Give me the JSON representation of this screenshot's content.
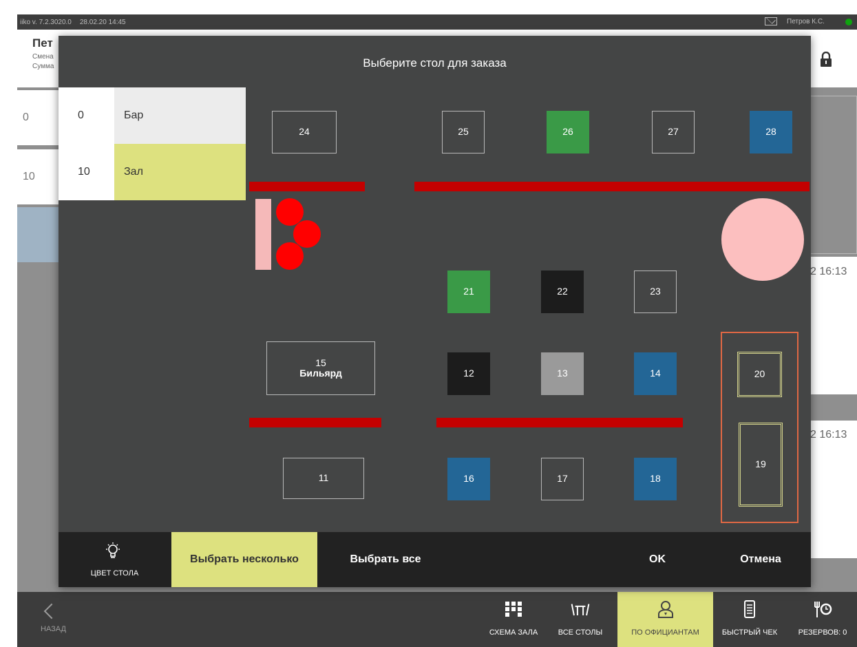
{
  "topbar": {
    "version": "iiko v. 7.2.3020.0",
    "datetime": "28.02.20  14:45",
    "user": "Петров К.С."
  },
  "background": {
    "waiter_name": "Пет",
    "line1": "Смена",
    "line2": "Сумма",
    "side_cells": [
      "0",
      "10"
    ],
    "times": [
      "2 16:13",
      "2 16:13"
    ]
  },
  "bottom_nav": {
    "back": "НАЗАД",
    "items": [
      {
        "label": "СХЕМА ЗАЛА",
        "icon": "grid-icon"
      },
      {
        "label": "ВСЕ СТОЛЫ",
        "icon": "table-icon"
      },
      {
        "label": "ПО ОФИЦИАНТАМ",
        "icon": "waiter-icon",
        "active": true
      },
      {
        "label": "БЫСТРЫЙ ЧЕК",
        "icon": "receipt-icon"
      },
      {
        "label": "РЕЗЕРВОВ: 0",
        "icon": "reserve-icon"
      }
    ]
  },
  "modal": {
    "title": "Выберите стол для заказа",
    "halls": [
      {
        "count": "0",
        "name": "Бар",
        "selected": false
      },
      {
        "count": "10",
        "name": "Зал",
        "selected": true
      }
    ],
    "tables": {
      "t24": "24",
      "t25": "25",
      "t26": "26",
      "t27": "27",
      "t28": "28",
      "t21": "21",
      "t22": "22",
      "t23": "23",
      "t15": "15",
      "t15_name": "Бильярд",
      "t12": "12",
      "t13": "13",
      "t14": "14",
      "t20": "20",
      "t11": "11",
      "t16": "16",
      "t17": "17",
      "t18": "18",
      "t19": "19"
    },
    "colors": {
      "green": "#3a9a47",
      "blue": "#236696",
      "black": "#1c1c1c",
      "gray": "#9a9a9a",
      "wall": "#c40000",
      "accent": "#dde17f"
    },
    "footer": {
      "table_color": "ЦВЕТ СТОЛА",
      "select_several": "Выбрать несколько",
      "select_all": "Выбрать все",
      "ok": "OK",
      "cancel": "Отмена"
    }
  }
}
